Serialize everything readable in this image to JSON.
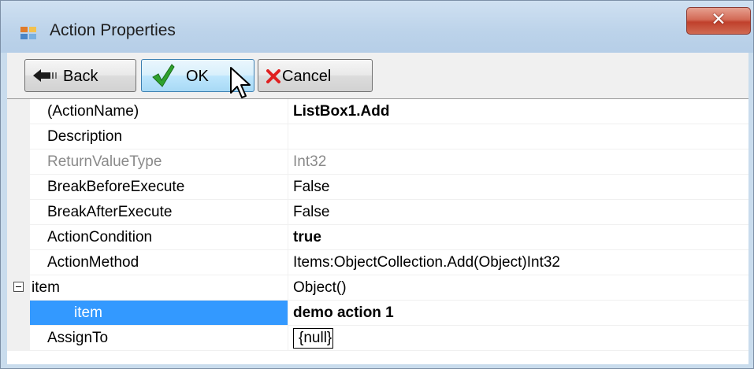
{
  "window": {
    "title": "Action Properties",
    "close_glyph": "✕",
    "icon": "app-form-icon"
  },
  "toolbar": {
    "back_label": "Back",
    "ok_label": "OK",
    "cancel_label": "Cancel",
    "back_icon": "back-arrow-icon",
    "ok_icon": "green-checkmark-icon",
    "cancel_icon": "red-x-icon"
  },
  "properties": [
    {
      "name": "(ActionName)",
      "value": "ListBox1.Add",
      "value_bold": true
    },
    {
      "name": "Description",
      "value": ""
    },
    {
      "name": "ReturnValueType",
      "value": "Int32",
      "disabled": true
    },
    {
      "name": "BreakBeforeExecute",
      "value": "False"
    },
    {
      "name": "BreakAfterExecute",
      "value": "False"
    },
    {
      "name": "ActionCondition",
      "value": "true",
      "value_bold": true
    },
    {
      "name": "ActionMethod",
      "value": "Items:ObjectCollection.Add(Object)Int32"
    },
    {
      "name": "item",
      "value": "Object()",
      "expanded": true
    },
    {
      "name": "item",
      "value": "demo action 1",
      "value_bold": true,
      "selected": true,
      "indent": true
    },
    {
      "name": "AssignTo",
      "value": "{null}",
      "editing": true
    }
  ],
  "colors": {
    "selection": "#3399ff",
    "titlebar": "#bcd3ea",
    "close_button": "#c0402c"
  }
}
